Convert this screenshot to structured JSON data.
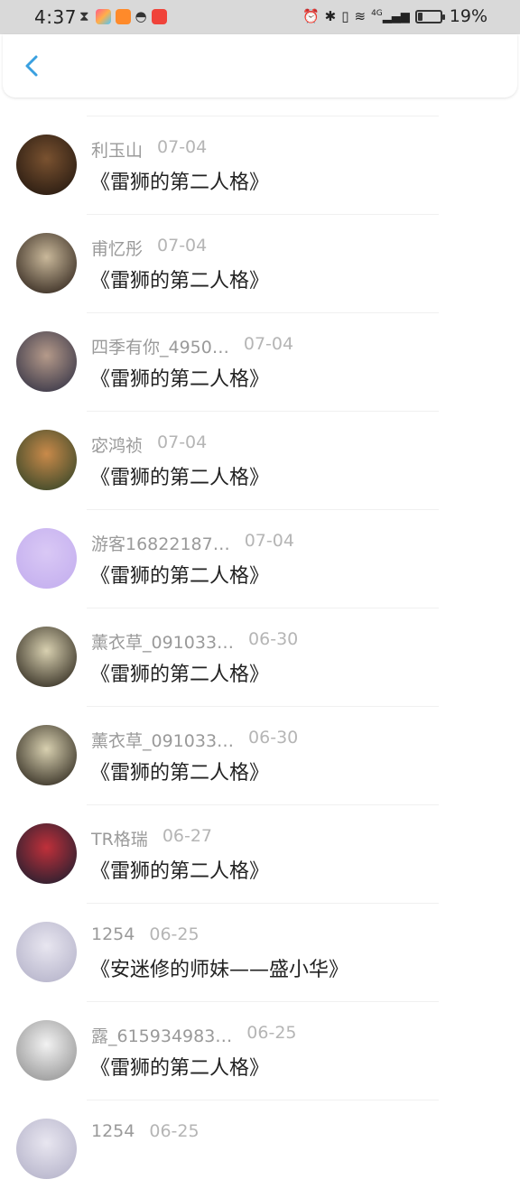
{
  "status_bar": {
    "time": "4:37",
    "battery": "19%",
    "battery_level": 0.19,
    "network": "4G"
  },
  "header": {
    "back_icon": "chevron-left-icon"
  },
  "items": [
    {
      "name": "利玉山",
      "date": "07-04",
      "title": "《雷狮的第二人格》",
      "avatar_colors": [
        "#7a5230",
        "#2a1c12"
      ]
    },
    {
      "name": "甫忆彤",
      "date": "07-04",
      "title": "《雷狮的第二人格》",
      "avatar_colors": [
        "#c9b89a",
        "#3b2f25"
      ]
    },
    {
      "name": "四季有你_4950…",
      "date": "07-04",
      "title": "《雷狮的第二人格》",
      "avatar_colors": [
        "#b59a8a",
        "#3d3a4a"
      ]
    },
    {
      "name": "宓鸿祯",
      "date": "07-04",
      "title": "《雷狮的第二人格》",
      "avatar_colors": [
        "#c98a4a",
        "#3f4a2a"
      ]
    },
    {
      "name": "游客16822187…",
      "date": "07-04",
      "title": "《雷狮的第二人格》",
      "avatar_colors": [
        "#d9c8f5",
        "#c5b0ef"
      ]
    },
    {
      "name": "薰衣草_091033…",
      "date": "06-30",
      "title": "《雷狮的第二人格》",
      "avatar_colors": [
        "#d8d0b0",
        "#3a3428"
      ]
    },
    {
      "name": "薰衣草_091033…",
      "date": "06-30",
      "title": "《雷狮的第二人格》",
      "avatar_colors": [
        "#d8d0b0",
        "#3a3428"
      ]
    },
    {
      "name": "TR格瑞",
      "date": "06-27",
      "title": "《雷狮的第二人格》",
      "avatar_colors": [
        "#c0303a",
        "#2a2030"
      ]
    },
    {
      "name": "1254",
      "date": "06-25",
      "title": "《安迷修的师妹——盛小华》",
      "avatar_colors": [
        "#e8e6f0",
        "#b8b6cc"
      ]
    },
    {
      "name": "露_615934983…",
      "date": "06-25",
      "title": "《雷狮的第二人格》",
      "avatar_colors": [
        "#f2f2f2",
        "#9a9a9a"
      ]
    },
    {
      "name": "1254",
      "date": "06-25",
      "title": "",
      "avatar_colors": [
        "#e8e6f0",
        "#b8b6cc"
      ]
    }
  ]
}
